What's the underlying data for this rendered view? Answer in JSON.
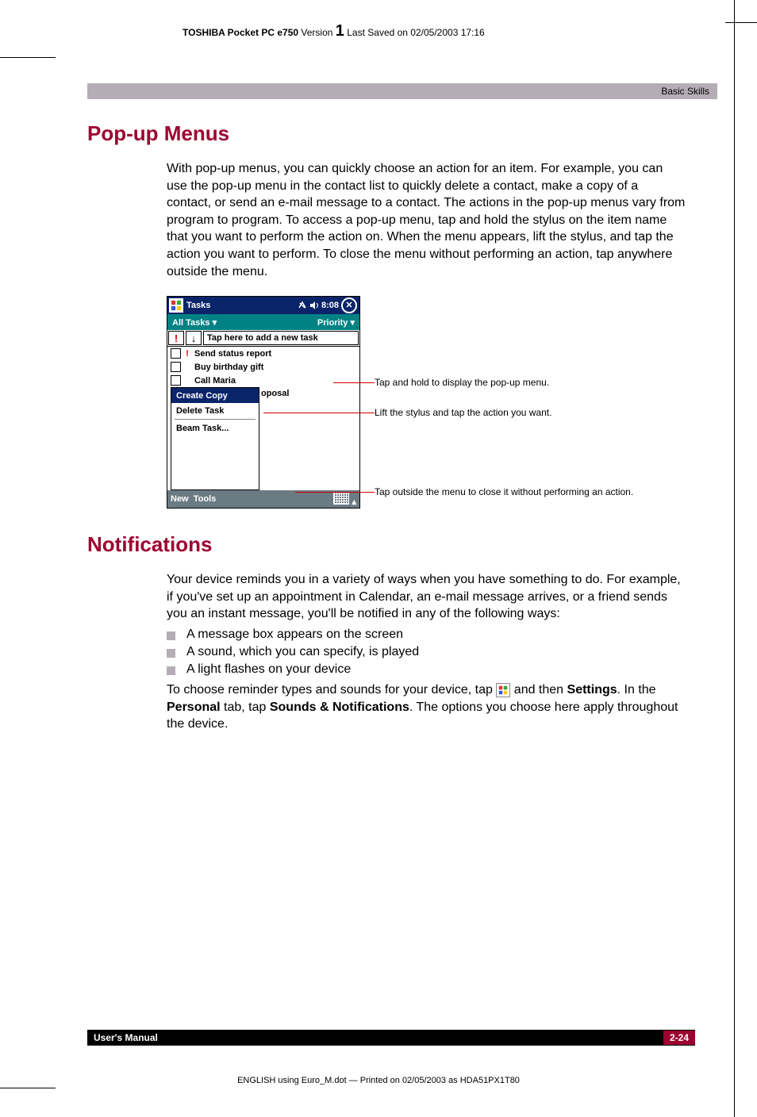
{
  "header": {
    "product_bold": "TOSHIBA Pocket PC e750",
    "version_label": "Version",
    "version_num": "1",
    "saved": "Last Saved on 02/05/2003 17:16"
  },
  "topbar": {
    "section": "Basic Skills"
  },
  "sections": {
    "popup": {
      "title": "Pop-up Menus",
      "para": "With pop-up menus, you can quickly choose an action for an item. For example, you can use the pop-up menu in the contact list to quickly delete a contact, make a copy of a contact, or send an e-mail message to a contact. The actions in the pop-up menus vary from program to program. To access a pop-up menu, tap and hold the stylus on the item name that you want to perform the action on. When the menu appears, lift the stylus, and tap the action you want to perform. To close the menu without performing an action, tap anywhere outside the menu."
    },
    "notif": {
      "title": "Notifications",
      "para": "Your device reminds you in a variety of ways when you have something to do. For example, if you've set up an appointment in Calendar, an e-mail message arrives, or a friend sends you an instant message, you'll be notified in any of the following ways:",
      "bullets": [
        "A message box appears on the screen",
        "A sound, which you can specify, is played",
        "A light flashes on your device"
      ],
      "para2_a": "To choose reminder types and sounds for your device, tap ",
      "para2_b": " and then ",
      "para2_settings": "Settings",
      "para2_c": ". In the ",
      "para2_personal": "Personal",
      "para2_d": " tab, tap ",
      "para2_sounds": "Sounds & Notifications",
      "para2_e": ". The options you choose here apply throughout the device."
    }
  },
  "ppc": {
    "title": "Tasks",
    "time": "8:08",
    "toolbar_left": "All Tasks",
    "toolbar_right": "Priority",
    "newtask_priority": "!",
    "newtask_arrow": "↓",
    "newtask_text": "Tap here to add a new task",
    "items": [
      {
        "priority": "!",
        "label": "Send status report"
      },
      {
        "priority": "",
        "label": "Buy birthday gift"
      },
      {
        "priority": "",
        "label": "Call Maria"
      }
    ],
    "truncated": "oposal",
    "context_menu": [
      "Create Copy",
      "Delete Task",
      "Beam Task..."
    ],
    "bottom_left": "New",
    "bottom_tools": "Tools"
  },
  "callouts": {
    "c1": "Tap and hold to display the pop-up menu.",
    "c2": "Lift the stylus and tap the action you want.",
    "c3": "Tap outside the menu to close it without performing an action."
  },
  "footer": {
    "manual": "User's Manual",
    "page": "2-24",
    "print": "ENGLISH using Euro_M.dot — Printed on 02/05/2003 as HDA51PX1T80"
  }
}
